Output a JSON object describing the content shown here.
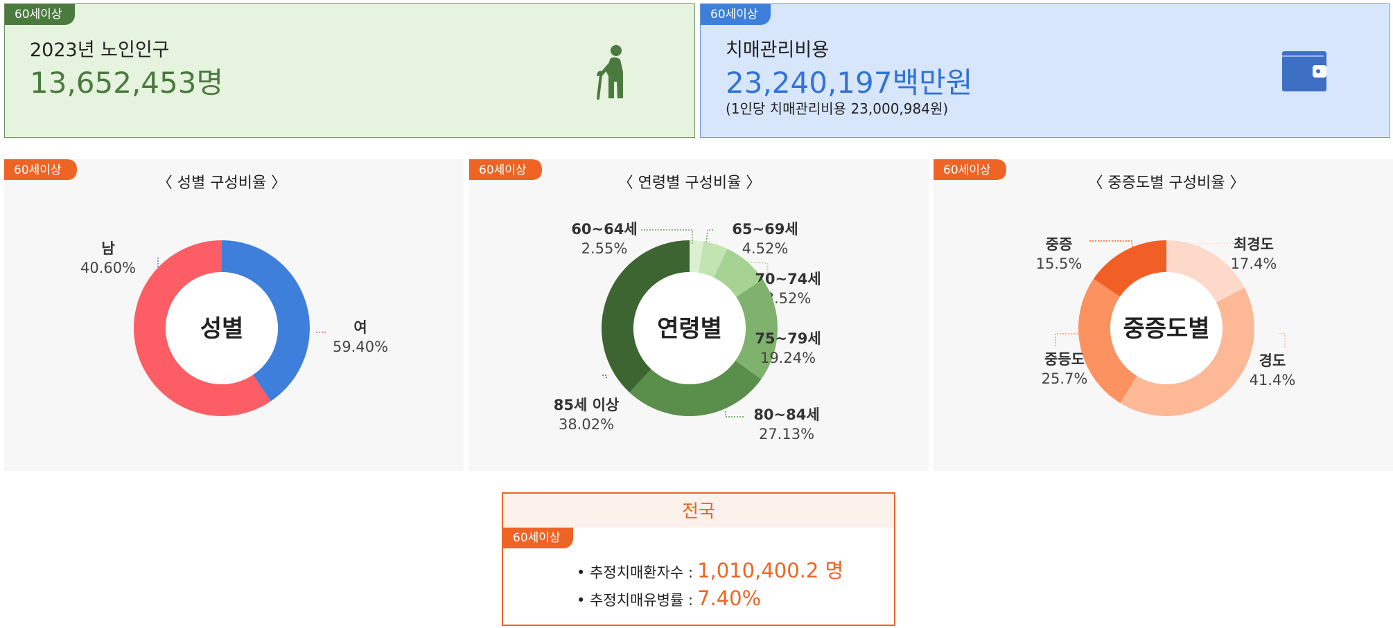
{
  "badge": "60세이상",
  "population": {
    "label": "2023년 노인인구",
    "value": "13,652,453명",
    "icon": "elderly-person-icon",
    "color": "#4b7a3f"
  },
  "cost": {
    "label": "치매관리비용",
    "value": "23,240,197백만원",
    "sub": "(1인당 치매관리비용 23,000,984원)",
    "icon": "wallet-icon",
    "color": "#3273d6"
  },
  "chart_data": [
    {
      "id": "gender",
      "type": "pie",
      "title": "〈 성별 구성비율 〉",
      "center_label": "성별",
      "slices": [
        {
          "label": "남",
          "value": 40.6,
          "display": "40.60%",
          "color": "#3f7fdc"
        },
        {
          "label": "여",
          "value": 59.4,
          "display": "59.40%",
          "color": "#fd5d64"
        }
      ]
    },
    {
      "id": "age",
      "type": "pie",
      "title": "〈 연령별 구성비율 〉",
      "center_label": "연령별",
      "slices": [
        {
          "label": "60~64세",
          "value": 2.55,
          "display": "2.55%",
          "color": "#dcf0d2"
        },
        {
          "label": "65~69세",
          "value": 4.52,
          "display": "4.52%",
          "color": "#c2e3b2"
        },
        {
          "label": "70~74세",
          "value": 8.52,
          "display": "8.52%",
          "color": "#a6d393"
        },
        {
          "label": "75~79세",
          "value": 19.24,
          "display": "19.24%",
          "color": "#7fb26d"
        },
        {
          "label": "80~84세",
          "value": 27.13,
          "display": "27.13%",
          "color": "#5a8f4b"
        },
        {
          "label": "85세 이상",
          "value": 38.02,
          "display": "38.02%",
          "color": "#3c6532"
        }
      ]
    },
    {
      "id": "severity",
      "type": "pie",
      "title": "〈 중증도별 구성비율 〉",
      "center_label": "중증도별",
      "slices": [
        {
          "label": "최경도",
          "value": 17.4,
          "display": "17.4%",
          "color": "#fdd9ca"
        },
        {
          "label": "경도",
          "value": 41.4,
          "display": "41.4%",
          "color": "#fdb896"
        },
        {
          "label": "중등도",
          "value": 25.7,
          "display": "25.7%",
          "color": "#fb9260"
        },
        {
          "label": "중증",
          "value": 15.5,
          "display": "15.5%",
          "color": "#f25f26"
        }
      ]
    }
  ],
  "summary": {
    "title": "전국",
    "rows": [
      {
        "label": "• 추정치매환자수 :",
        "value": "1,010,400.2 명"
      },
      {
        "label": "• 추정치매유병률 :",
        "value": "7.40%"
      }
    ]
  }
}
